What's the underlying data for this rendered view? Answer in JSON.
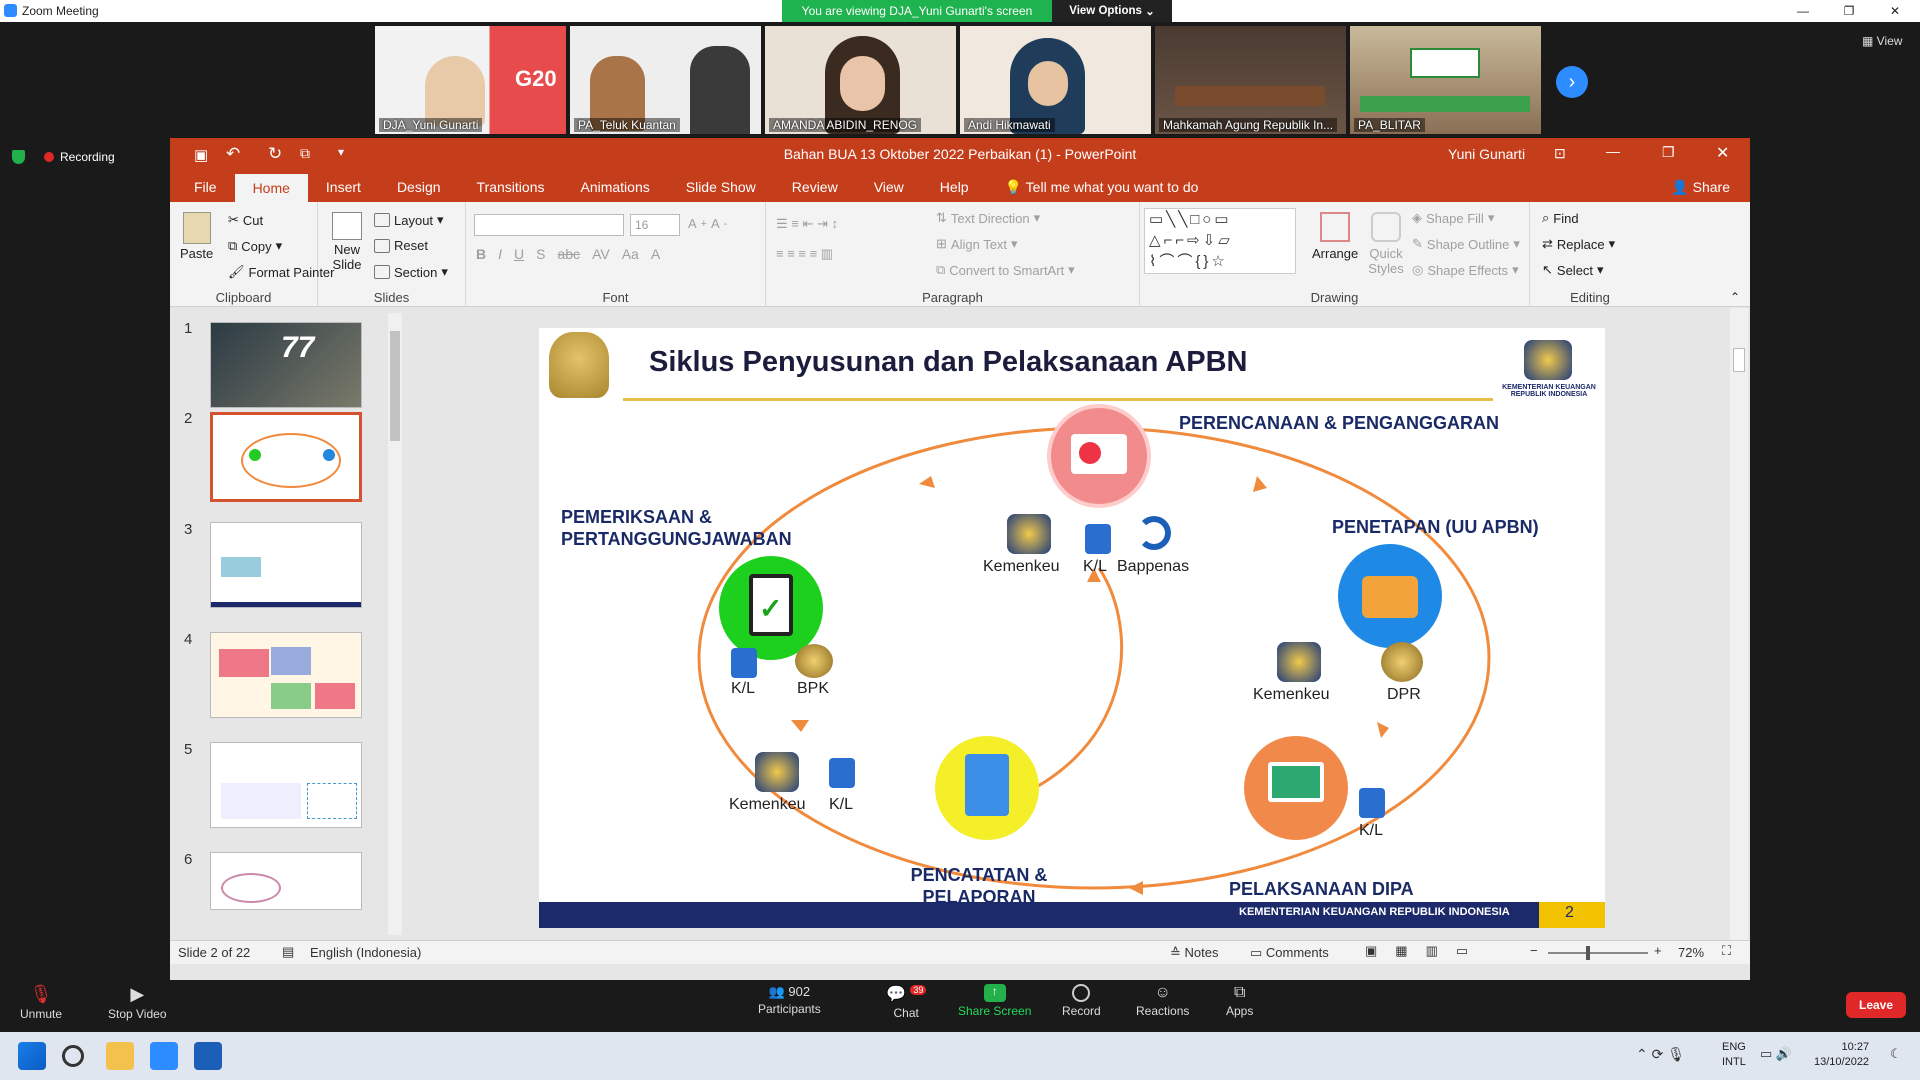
{
  "zoom": {
    "window_title": "Zoom Meeting",
    "viewing_text": "You are viewing DJA_Yuni Gunarti's screen",
    "view_options": "View Options",
    "view_label": "View",
    "recording": "Recording",
    "participants_tiles": [
      {
        "name": "DJA_Yuni Gunarti"
      },
      {
        "name": "PA_Teluk Kuantan"
      },
      {
        "name": "AMANDA ABIDIN_RENOG"
      },
      {
        "name": "Andi Hikmawati"
      },
      {
        "name": "Mahkamah Agung Republik In..."
      },
      {
        "name": "PA_BLITAR"
      }
    ],
    "toolbar": {
      "unmute": "Unmute",
      "stop_video": "Stop Video",
      "participants": "Participants",
      "participants_count": "902",
      "chat": "Chat",
      "chat_badge": "39",
      "share_screen": "Share Screen",
      "record": "Record",
      "reactions": "Reactions",
      "apps": "Apps",
      "leave": "Leave"
    }
  },
  "ppt": {
    "title": "Bahan BUA 13 Oktober 2022 Perbaikan (1)  -  PowerPoint",
    "user": "Yuni Gunarti",
    "tabs": [
      "File",
      "Home",
      "Insert",
      "Design",
      "Transitions",
      "Animations",
      "Slide Show",
      "Review",
      "View",
      "Help"
    ],
    "tell_me": "Tell me what you want to do",
    "share": "Share",
    "ribbon": {
      "paste": "Paste",
      "cut": "Cut",
      "copy": "Copy",
      "format_painter": "Format Painter",
      "clipboard": "Clipboard",
      "new_slide": "New Slide",
      "layout": "Layout",
      "reset": "Reset",
      "section": "Section",
      "slides": "Slides",
      "font_size": "16",
      "font": "Font",
      "text_direction": "Text Direction",
      "align_text": "Align Text",
      "convert_smartart": "Convert to SmartArt",
      "paragraph": "Paragraph",
      "arrange": "Arrange",
      "quick_styles": "Quick Styles",
      "shape_fill": "Shape Fill",
      "shape_outline": "Shape Outline",
      "shape_effects": "Shape Effects",
      "drawing": "Drawing",
      "find": "Find",
      "replace": "Replace",
      "select": "Select",
      "editing": "Editing"
    },
    "slide_numbers": [
      "1",
      "2",
      "3",
      "4",
      "5",
      "6"
    ],
    "status": {
      "slide_of": "Slide 2 of 22",
      "language": "English (Indonesia)",
      "notes": "Notes",
      "comments": "Comments",
      "zoom": "72%"
    }
  },
  "slide": {
    "title": "Siklus Penyusunan dan Pelaksanaan APBN",
    "logo_caption": "KEMENTERIAN KEUANGAN REPUBLIK INDONESIA",
    "stages": {
      "perencanaan": "PERENCANAAN & PENGANGGARAN",
      "penetapan": "PENETAPAN (UU APBN)",
      "pelaksanaan": "PELAKSANAAN DIPA",
      "pencatatan": "PENCATATAN & PELAPORAN",
      "pemeriksaan": "PEMERIKSAAN & PERTANGGUNGJAWABAN"
    },
    "actors": {
      "kemenkeu": "Kemenkeu",
      "kl": "K/L",
      "bappenas": "Bappenas",
      "dpr": "DPR",
      "bpk": "BPK"
    },
    "footer": "KEMENTERIAN KEUANGAN REPUBLIK INDONESIA",
    "page": "2"
  },
  "taskbar": {
    "lang1": "ENG",
    "lang2": "INTL",
    "time": "10:27",
    "date": "13/10/2022"
  }
}
